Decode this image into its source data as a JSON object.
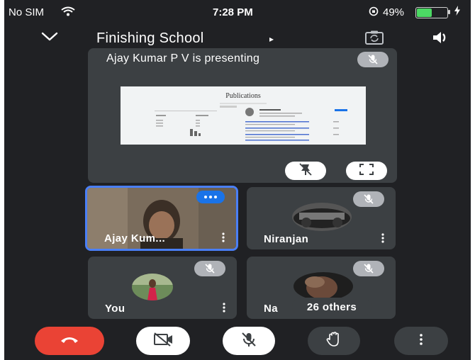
{
  "status_bar": {
    "carrier": "No SIM",
    "time": "7:28 PM",
    "battery_percent": "49%",
    "battery_level": 0.49
  },
  "header": {
    "title": "Finishing School",
    "title_arrow": "▸"
  },
  "presentation": {
    "label": "Ajay Kumar P V is presenting",
    "shared_doc_title": "Publications"
  },
  "tiles": [
    {
      "name": "Ajay Kum..."
    },
    {
      "name": "Niranjan"
    },
    {
      "name": "You"
    },
    {
      "name": "Na",
      "others_label": "26 others"
    }
  ],
  "colors": {
    "background": "#202124",
    "tile": "#3c4043",
    "accent_blue": "#1a73e8",
    "end_call_red": "#ea4335"
  },
  "icons": {
    "header": [
      "chevron-down-icon",
      "camera-switch-icon",
      "speaker-icon"
    ],
    "controls": [
      "end-call-icon",
      "camera-off-icon",
      "mic-off-icon",
      "raise-hand-icon",
      "more-vertical-icon"
    ]
  }
}
